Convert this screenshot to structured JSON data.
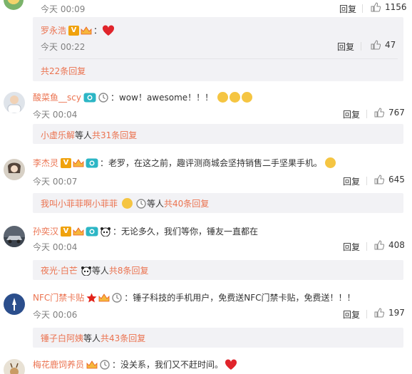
{
  "top": {
    "time": "今天 00:09",
    "reply": "回复",
    "likes": "1156"
  },
  "sub0": {
    "name": "罗永浩",
    "colon": "：",
    "time": "今天 00:22",
    "reply": "回复",
    "likes": "47",
    "more": "共22条回复"
  },
  "comments": [
    {
      "name": "酸菜鱼__scy",
      "colon": "：",
      "text": "wow！awesome！！！",
      "time": "今天 00:04",
      "reply": "回复",
      "likes": "767",
      "footer_name": "小虚乐解",
      "footer_mid": " 等人 ",
      "footer_count": "共31条回复"
    },
    {
      "name": "李杰灵",
      "colon": "：",
      "text": "老罗，在这之前，趣评测商城会坚持销售二手坚果手机。",
      "time": "今天 00:07",
      "reply": "回复",
      "likes": "645",
      "footer_name": "我叫小菲菲啊小菲菲",
      "footer_mid": " 等人 ",
      "footer_count": "共40条回复"
    },
    {
      "name": "孙奕汉",
      "colon": "：",
      "text": "无论多久，我们等你，锤友一直都在",
      "time": "今天 00:04",
      "reply": "回复",
      "likes": "408",
      "footer_name": "夜光·白芒",
      "footer_mid": " 等人 ",
      "footer_count": "共8条回复"
    },
    {
      "name": "NFC门禁卡贴",
      "colon": "：",
      "text": "锤子科技的手机用户，免费送NFC门禁卡贴，免费送！！！",
      "time": "今天 00:06",
      "reply": "回复",
      "likes": "197",
      "footer_name": "锤子白阿姨",
      "footer_mid": " 等人 ",
      "footer_count": "共43条回复"
    },
    {
      "name": "梅花鹿饲养员",
      "colon": "：",
      "text": "没关系，我们又不赶时间。"
    }
  ],
  "icons": {
    "like": "thumb-up-icon",
    "verified": "verified-v-icon",
    "crown": "crown-icon",
    "camera": "camera-icon",
    "watch": "watch-icon",
    "heart": "heart-icon",
    "panda": "panda-icon",
    "star": "star-icon"
  },
  "colors": {
    "link": "#eb7350",
    "muted": "#808080",
    "subbox_bg": "#f2f2f5"
  }
}
